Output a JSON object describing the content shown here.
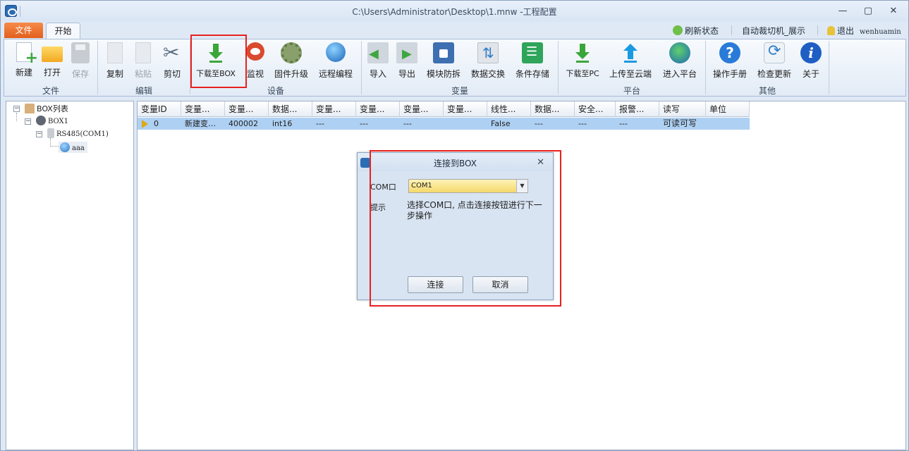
{
  "window": {
    "title": "C:\\Users\\Administrator\\Desktop\\1.mnw -工程配置",
    "minimize": "—",
    "maximize": "▢",
    "close": "✕"
  },
  "tabs": {
    "file": "文件",
    "start": "开始"
  },
  "tabbar_right": {
    "refresh": "刷新状态",
    "project": "自动裁切机_展示",
    "logout": "退出",
    "user": "wenhuamin"
  },
  "ribbon": {
    "file_group": {
      "label": "文件",
      "new": "新建",
      "open": "打开",
      "save": "保存"
    },
    "edit_group": {
      "label": "编辑",
      "copy": "复制",
      "paste": "粘贴",
      "cut": "剪切"
    },
    "device_group": {
      "label": "设备",
      "download_to_box": "下载至BOX",
      "monitor": "监视",
      "firmware": "固件升级",
      "remote": "远程编程"
    },
    "variable_group": {
      "label": "变量",
      "import": "导入",
      "export": "导出",
      "module_guard": "模块防拆",
      "data_exchange": "数据交换",
      "condition_store": "条件存储"
    },
    "platform_group": {
      "label": "平台",
      "download_to_pc": "下载至PC",
      "upload_cloud": "上传至云端",
      "enter_platform": "进入平台"
    },
    "other_group": {
      "label": "其他",
      "manual": "操作手册",
      "check_update": "检查更新",
      "about": "关于"
    }
  },
  "tree": {
    "root": "BOX列表",
    "box": "BOX1",
    "port": "RS485(COM1)",
    "device": "aaa"
  },
  "grid": {
    "columns": [
      "变量ID",
      "变量...",
      "变量...",
      "数据...",
      "变量...",
      "变量...",
      "变量...",
      "变量...",
      "线性...",
      "数据...",
      "安全...",
      "报警...",
      "读写",
      "单位"
    ],
    "rows": [
      [
        "0",
        "新建变…",
        "400002",
        "int16",
        "---",
        "---",
        "---",
        "",
        "False",
        "---",
        "---",
        "---",
        "可读可写",
        ""
      ]
    ]
  },
  "dialog": {
    "title": "连接到BOX",
    "com_label": "COM口",
    "com_value": "COM1",
    "hint_label": "提示",
    "hint_text": "选择COM口, 点击连接按钮进行下一步操作",
    "connect": "连接",
    "cancel": "取消"
  },
  "colors": {
    "highlight": "#e8201f",
    "selected_row": "#aed0f3",
    "file_tab": "#f07a3a"
  }
}
